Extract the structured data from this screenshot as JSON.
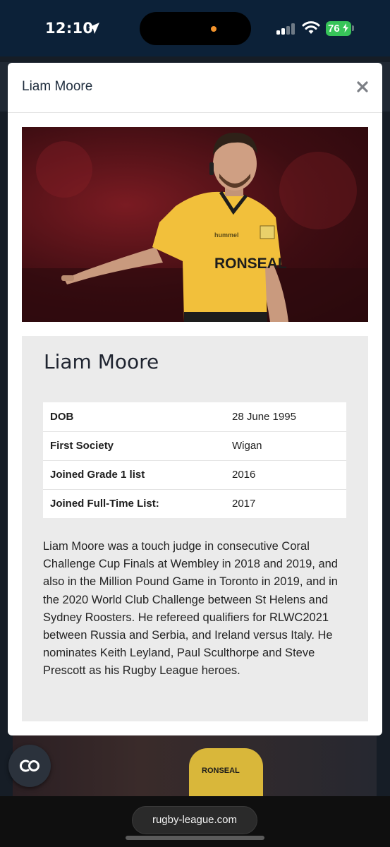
{
  "status_bar": {
    "time": "12:10",
    "battery": "76",
    "battery_color": "#37c459",
    "icons": [
      "location-arrow-icon",
      "cellular-signal-icon",
      "wifi-icon",
      "battery-charging-icon"
    ]
  },
  "background": {
    "sponsor": "RONSEAL"
  },
  "modal": {
    "title": "Liam Moore",
    "close_icon": "close-icon",
    "photo": {
      "kit_brand": "hummel",
      "sponsor": "RONSEAL",
      "shirt_color": "#f2c03b"
    },
    "profile": {
      "name": "Liam Moore",
      "facts": [
        {
          "label": "DOB",
          "value": "28 June 1995"
        },
        {
          "label": "First Society",
          "value": "Wigan"
        },
        {
          "label": "Joined Grade 1 list",
          "value": "2016"
        },
        {
          "label": "Joined Full-Time List:",
          "value": "2017"
        }
      ],
      "bio": "Liam Moore was a touch judge in consecutive Coral Challenge Cup Finals at Wembley in 2018 and 2019, and also in the Million Pound Game in Toronto in 2019, and in the 2020 World Club Challenge between St Helens and Sydney Roosters. He refereed qualifiers for RLWC2021 between Russia and Serbia, and Ireland versus Italy. He nominates Keith Leyland, Paul Sculthorpe and Steve Prescott as his Rugby League heroes."
    }
  },
  "floating_button": {
    "icon": "co-logo-icon"
  },
  "browser": {
    "url": "rugby-league.com"
  }
}
